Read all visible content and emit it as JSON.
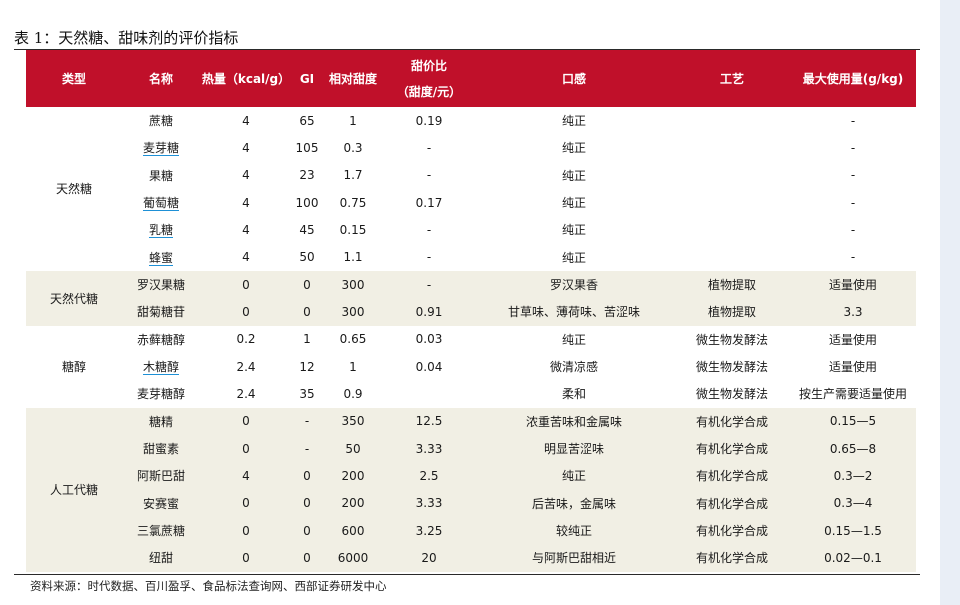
{
  "title": "表 1：天然糖、甜味剂的评价指标",
  "headers": [
    "类型",
    "名称",
    "热量（kcal/g）",
    "GI",
    "相对甜度",
    "甜价比",
    "（甜度/元）",
    "口感",
    "工艺",
    "最大使用量(g/kg)"
  ],
  "groups": {
    "g1": "天然糖",
    "g2": "天然代糖",
    "g3": "糖醇",
    "g4": "人工代糖"
  },
  "rows": [
    [
      "蔗糖",
      "4",
      "65",
      "1",
      "0.19",
      "纯正",
      "",
      "-"
    ],
    [
      "麦芽糖",
      "4",
      "105",
      "0.3",
      "-",
      "纯正",
      "",
      "-"
    ],
    [
      "果糖",
      "4",
      "23",
      "1.7",
      "-",
      "纯正",
      "",
      "-"
    ],
    [
      "葡萄糖",
      "4",
      "100",
      "0.75",
      "0.17",
      "纯正",
      "",
      "-"
    ],
    [
      "乳糖",
      "4",
      "45",
      "0.15",
      "-",
      "纯正",
      "",
      "-"
    ],
    [
      "蜂蜜",
      "4",
      "50",
      "1.1",
      "-",
      "纯正",
      "",
      "-"
    ],
    [
      "罗汉果糖",
      "0",
      "0",
      "300",
      "-",
      "罗汉果香",
      "植物提取",
      "适量使用"
    ],
    [
      "甜菊糖苷",
      "0",
      "0",
      "300",
      "0.91",
      "甘草味、薄荷味、苦涩味",
      "植物提取",
      "3.3"
    ],
    [
      "赤藓糖醇",
      "0.2",
      "1",
      "0.65",
      "0.03",
      "纯正",
      "微生物发酵法",
      "适量使用"
    ],
    [
      "木糖醇",
      "2.4",
      "12",
      "1",
      "0.04",
      "微清凉感",
      "微生物发酵法",
      "适量使用"
    ],
    [
      "麦芽糖醇",
      "2.4",
      "35",
      "0.9",
      "",
      "柔和",
      "微生物发酵法",
      "按生产需要适量使用"
    ],
    [
      "糖精",
      "0",
      "-",
      "350",
      "12.5",
      "浓重苦味和金属味",
      "有机化学合成",
      "0.15—5"
    ],
    [
      "甜蜜素",
      "0",
      "-",
      "50",
      "3.33",
      "明显苦涩味",
      "有机化学合成",
      "0.65—8"
    ],
    [
      "阿斯巴甜",
      "4",
      "0",
      "200",
      "2.5",
      "纯正",
      "有机化学合成",
      "0.3—2"
    ],
    [
      "安赛蜜",
      "0",
      "0",
      "200",
      "3.33",
      "后苦味，金属味",
      "有机化学合成",
      "0.3—4"
    ],
    [
      "三氯蔗糖",
      "0",
      "0",
      "600",
      "3.25",
      "较纯正",
      "有机化学合成",
      "0.15—1.5"
    ],
    [
      "纽甜",
      "0",
      "0",
      "6000",
      "20",
      "与阿斯巴甜相近",
      "有机化学合成",
      "0.02—0.1"
    ]
  ],
  "source": "资料来源：时代数据、百川盈孚、食品标法查询网、西部证券研发中心",
  "colors": {
    "header_bg": "#c0102a",
    "alt_bg": "#f1efe4",
    "underline": "#1e90d6"
  }
}
